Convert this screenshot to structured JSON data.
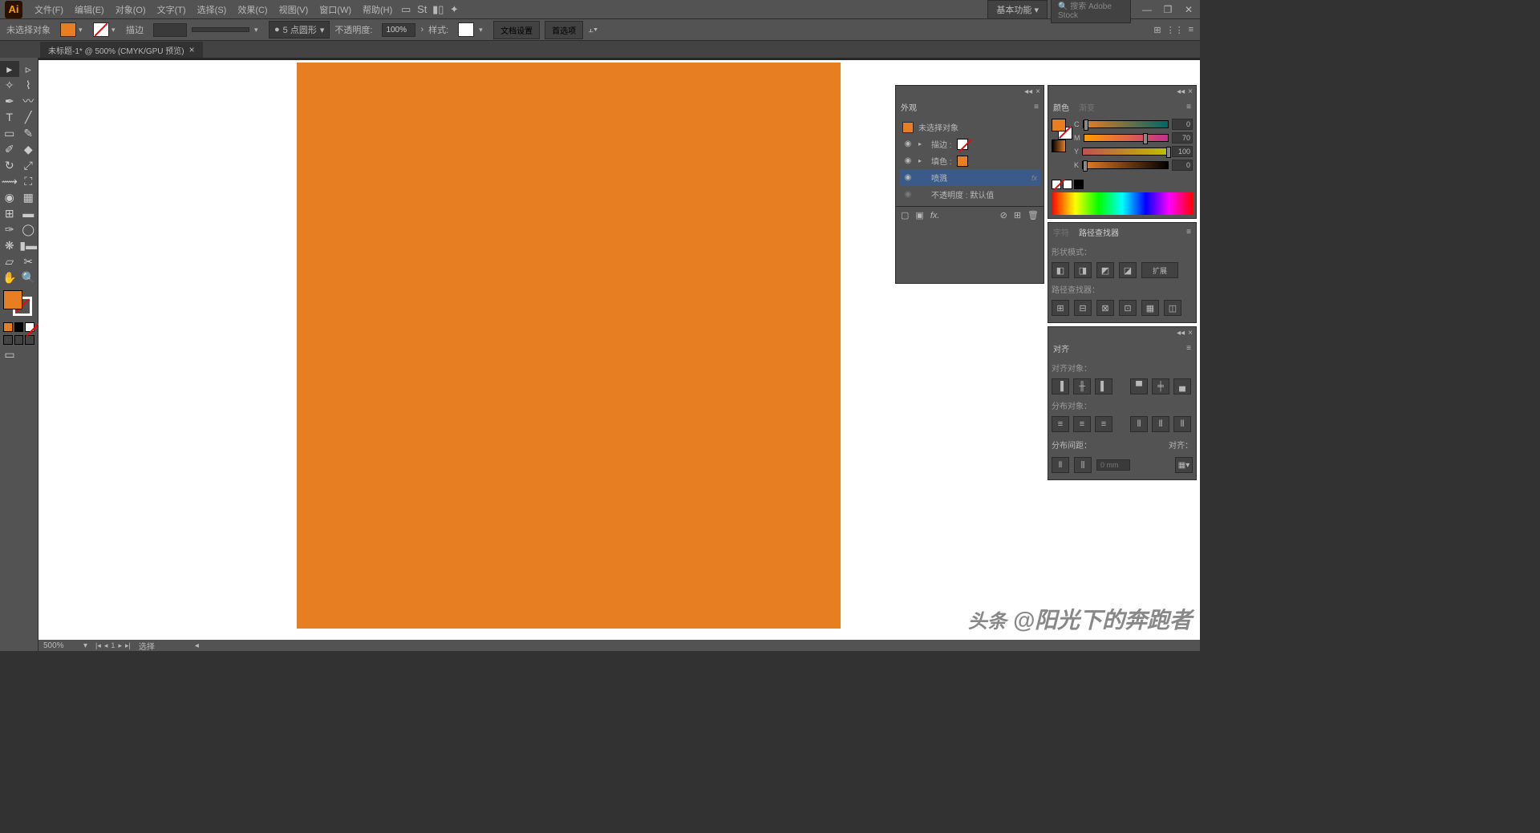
{
  "menubar": {
    "items": [
      "文件(F)",
      "编辑(E)",
      "对象(O)",
      "文字(T)",
      "选择(S)",
      "效果(C)",
      "视图(V)",
      "窗口(W)",
      "帮助(H)"
    ],
    "workspace": "基本功能",
    "search_placeholder": "搜索 Adobe Stock"
  },
  "controlbar": {
    "selection_label": "未选择对象",
    "stroke_label": "描边",
    "stroke_value": "",
    "shape_label": "5 点圆形",
    "opacity_label": "不透明度:",
    "opacity_value": "100%",
    "style_label": "样式:",
    "docsetup_btn": "文档设置",
    "prefs_btn": "首选项"
  },
  "doctab": {
    "title": "未标题-1* @ 500% (CMYK/GPU 预览)"
  },
  "statusbar": {
    "zoom": "500%",
    "page": "1",
    "tool": "选择"
  },
  "appearance": {
    "tab": "外观",
    "noselection": "未选择对象",
    "rows": [
      {
        "label": "描边 :",
        "type": "stroke"
      },
      {
        "label": "填色 :",
        "type": "fill"
      },
      {
        "label": "喷溅",
        "type": "effect",
        "selected": true,
        "fx": "fx"
      },
      {
        "label": "不透明度 : 默认值",
        "type": "opacity"
      }
    ]
  },
  "color": {
    "tab1": "颜色",
    "tab2": "渐变",
    "channels": [
      {
        "name": "C",
        "value": 0,
        "cls": "slider-c",
        "pos": 0
      },
      {
        "name": "M",
        "value": 70,
        "cls": "slider-m",
        "pos": 70
      },
      {
        "name": "Y",
        "value": 100,
        "cls": "slider-y",
        "pos": 100
      },
      {
        "name": "K",
        "value": 0,
        "cls": "slider-k",
        "pos": 0
      }
    ]
  },
  "pathfinder": {
    "tab1": "字符",
    "tab2": "路径查找器",
    "shape_mode_label": "形状模式：",
    "pathfinder_label": "路径查找器：",
    "expand_btn": "扩展"
  },
  "align": {
    "tab": "对齐",
    "align_label": "对齐对象：",
    "distribute_label": "分布对象：",
    "spacing_label": "分布间距：",
    "alignto_label": "对齐：",
    "spacing_value": "0 mm"
  },
  "watermark": {
    "prefix": "头条",
    "text": "@阳光下的奔跑者"
  }
}
